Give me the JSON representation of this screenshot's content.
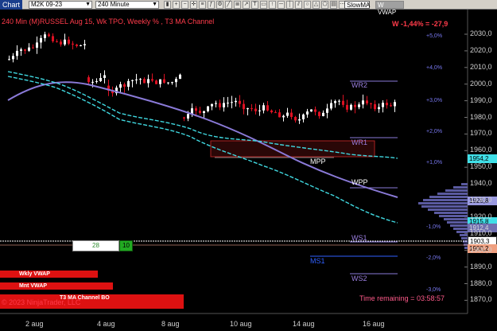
{
  "toolbar": {
    "tab_label": "Chart",
    "instrument": "M2K 09-23",
    "interval": "240 Minute",
    "dropdown_slow": "SlowMA",
    "dropdown_vwap": "W VWAP"
  },
  "chart": {
    "title": "240 Min (M)RUSSEL Aug 15, Wk TPO, Weekly % , T3 MA Channel",
    "change_label": "W -1,44% = -27,9",
    "copyright": "© 2023 NinjaTrader, LLC",
    "time_remaining": "Time remaining = 03:58:57",
    "levels": {
      "wr2": "WR2",
      "wr1": "WR1",
      "mpp": "MPP",
      "wpp": "WPP",
      "ws1": "WS1",
      "ms1": "MS1",
      "ws2": "WS2"
    },
    "buttons": {
      "wkly": "Wkly VWAP",
      "mnt": "Mnt VWAP",
      "t3": "T3 MA Channel BO"
    },
    "box_left": "28",
    "box_right": "10",
    "price_tags": {
      "p1": "1954,2",
      "p2": "1928,8",
      "p3": "1915,8",
      "p4": "1912,4",
      "p5": "1903,3",
      "p6": "1900,2"
    },
    "y_ticks": [
      "2030,0",
      "2020,0",
      "2010,0",
      "2000,0",
      "1990,0",
      "1980,0",
      "1970,0",
      "1960,0",
      "1950,0",
      "1940,0",
      "1930,0",
      "1920,0",
      "1910,0",
      "1900,0",
      "1890,0",
      "1880,0",
      "1870,0"
    ],
    "pct_ticks": [
      "+5,0%",
      "+4,0%",
      "+3,0%",
      "+2,0%",
      "+1,0%",
      "-1,0%",
      "-2,0%",
      "-3,0%"
    ],
    "x_ticks": [
      "2 aug",
      "4 aug",
      "8 aug",
      "10 aug",
      "14 aug",
      "16 aug"
    ]
  },
  "colors": {
    "up": "#ffffff",
    "down": "#dd1122",
    "ma_slow": "#8a7ad8",
    "ma_fast": "#40d8e0",
    "bar": "#5a5aa0"
  }
}
